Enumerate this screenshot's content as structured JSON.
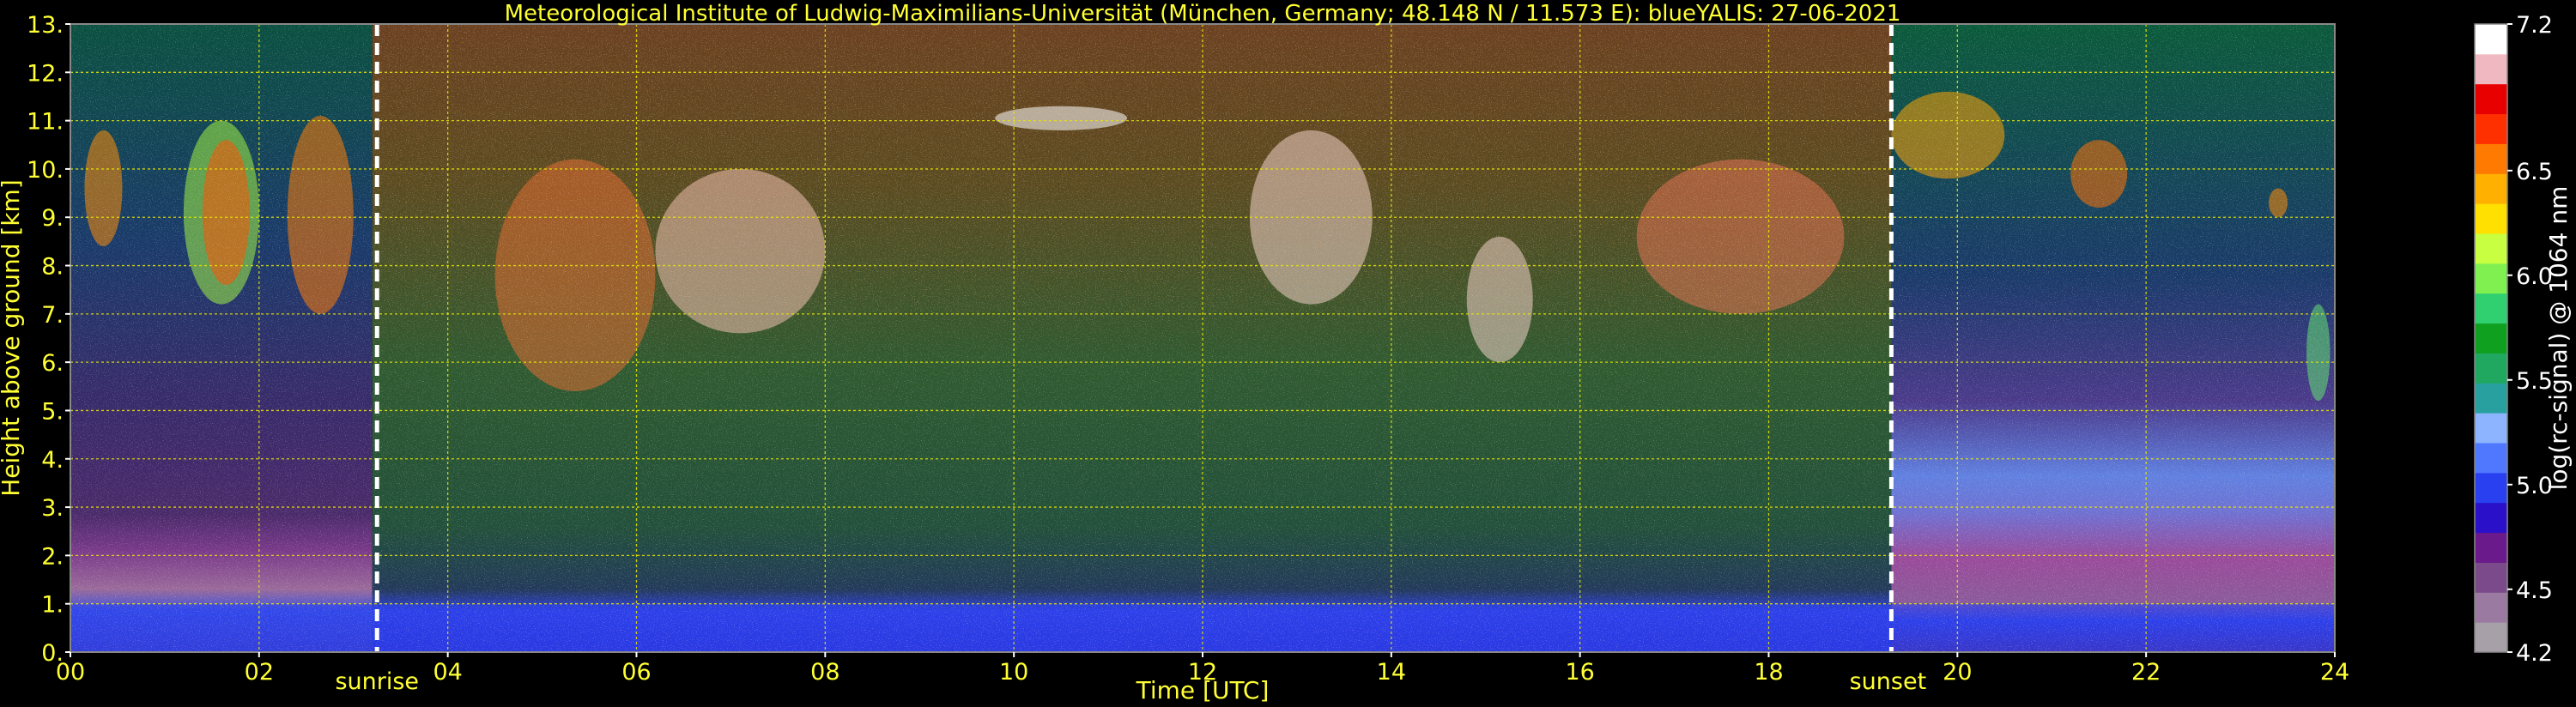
{
  "chart_data": {
    "type": "heatmap",
    "title": "Meteorological Institute of Ludwig-Maximilians-Universität (München, Germany; 48.148 N / 11.573 E):     blueYALIS: 27-06-2021",
    "xlabel": "Time [UTC]",
    "ylabel": "Height above ground [km]",
    "xlim": [
      0,
      24
    ],
    "ylim": [
      0,
      13
    ],
    "x_ticks": [
      0,
      2,
      4,
      6,
      8,
      10,
      12,
      14,
      16,
      18,
      20,
      22,
      24
    ],
    "x_tick_labels": [
      "00",
      "02",
      "04",
      "06",
      "08",
      "10",
      "12",
      "14",
      "16",
      "18",
      "20",
      "22",
      "24"
    ],
    "y_ticks": [
      0,
      1,
      2,
      3,
      4,
      5,
      6,
      7,
      8,
      9,
      10,
      11,
      12,
      13
    ],
    "y_tick_labels": [
      "0.",
      "1.",
      "2.",
      "3.",
      "4.",
      "5.",
      "6.",
      "7.",
      "8.",
      "9.",
      "10.",
      "11.",
      "12.",
      "13."
    ],
    "grid": true,
    "annotations": [
      {
        "label": "sunrise",
        "time": 3.25
      },
      {
        "label": "sunset",
        "time": 19.3
      }
    ],
    "colorbar": {
      "label": "log(rc-signal) @ 1064 nm",
      "range": [
        4.2,
        7.2
      ],
      "ticks": [
        4.2,
        4.5,
        5.0,
        5.5,
        6.0,
        6.5,
        7.2
      ],
      "tick_labels": [
        "4.2",
        "4.5",
        "5.0",
        "5.5",
        "6.0",
        "6.5",
        "7.2"
      ],
      "colors": [
        "#a8a0a8",
        "#9a7aa0",
        "#7a4a8a",
        "#6a1a8a",
        "#2a10c8",
        "#2840f0",
        "#5078ff",
        "#8cb4ff",
        "#28a0a0",
        "#20a860",
        "#10a020",
        "#30d070",
        "#80f050",
        "#c8ff40",
        "#ffe000",
        "#ffb000",
        "#ff7a00",
        "#ff3000",
        "#e80000",
        "#f0b8c0",
        "#ffffff"
      ]
    }
  }
}
